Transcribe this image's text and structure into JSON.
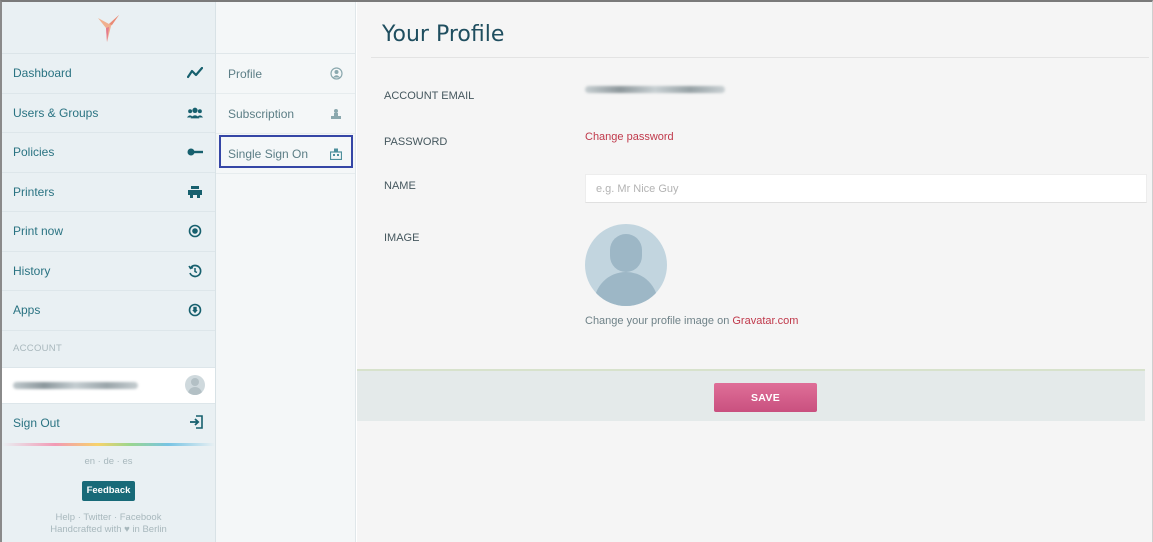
{
  "nav": {
    "items": [
      {
        "label": "Dashboard",
        "icon": "activity-icon"
      },
      {
        "label": "Users & Groups",
        "icon": "users-icon"
      },
      {
        "label": "Policies",
        "icon": "key-icon"
      },
      {
        "label": "Printers",
        "icon": "printer-icon"
      },
      {
        "label": "Print now",
        "icon": "print-now-icon"
      },
      {
        "label": "History",
        "icon": "history-icon"
      },
      {
        "label": "Apps",
        "icon": "apps-icon"
      }
    ],
    "account_label": "ACCOUNT",
    "sign_out": "Sign Out",
    "languages": "en · de · es",
    "feedback": "Feedback",
    "footer_links": "Help · Twitter · Facebook",
    "footer_credit": "Handcrafted with ♥ in Berlin"
  },
  "subnav": {
    "items": [
      {
        "label": "Profile",
        "icon": "user-circle-icon"
      },
      {
        "label": "Subscription",
        "icon": "subscription-icon"
      },
      {
        "label": "Single Sign On",
        "icon": "sso-icon",
        "active": true
      }
    ]
  },
  "profile": {
    "title": "Your Profile",
    "email_label": "ACCOUNT EMAIL",
    "password_label": "PASSWORD",
    "change_password": "Change password",
    "name_label": "NAME",
    "name_placeholder": "e.g. Mr Nice Guy",
    "name_value": "",
    "image_label": "IMAGE",
    "gravatar_text": "Change your profile image on ",
    "gravatar_link": "Gravatar.com",
    "save": "SAVE"
  },
  "colors": {
    "accent": "#c0394b",
    "sidebar_bg": "#e9f0f3",
    "nav_text": "#2a7382",
    "save_button": "#d35d8a",
    "active_outline": "#3546a6"
  }
}
